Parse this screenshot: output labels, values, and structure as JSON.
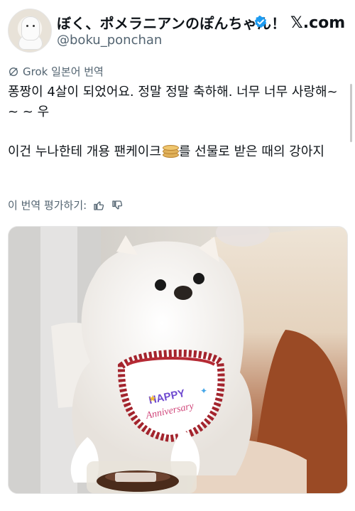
{
  "header": {
    "display_name": "ぼく、ポメラニアンのぽんちゃん！",
    "handle": "@boku_ponchan",
    "site_logo": "𝕏.com",
    "verified_icon": "verified-badge-icon"
  },
  "translation": {
    "label": "Grok 일본어 번역",
    "icon": "translate-icon"
  },
  "tweet": {
    "paragraph1": "퐁짱이 4살이 되었어요. 정말 정말 축하해. 너무 너무 사랑해~ ~ ~ 우",
    "paragraph2_before": "이건 누나한테 개용 팬케이크",
    "paragraph2_after": "를 선물로 받은 때의 강아지",
    "emoji": "pancakes-icon"
  },
  "feedback": {
    "label": "이 번역 평가하기:",
    "like_icon": "thumbs-up-icon",
    "dislike_icon": "thumbs-down-icon"
  },
  "media": {
    "bib_text": "HAPPY Anniversary"
  },
  "colors": {
    "accent": "#1d9bf0",
    "muted": "#536471",
    "text": "#0f1419"
  }
}
